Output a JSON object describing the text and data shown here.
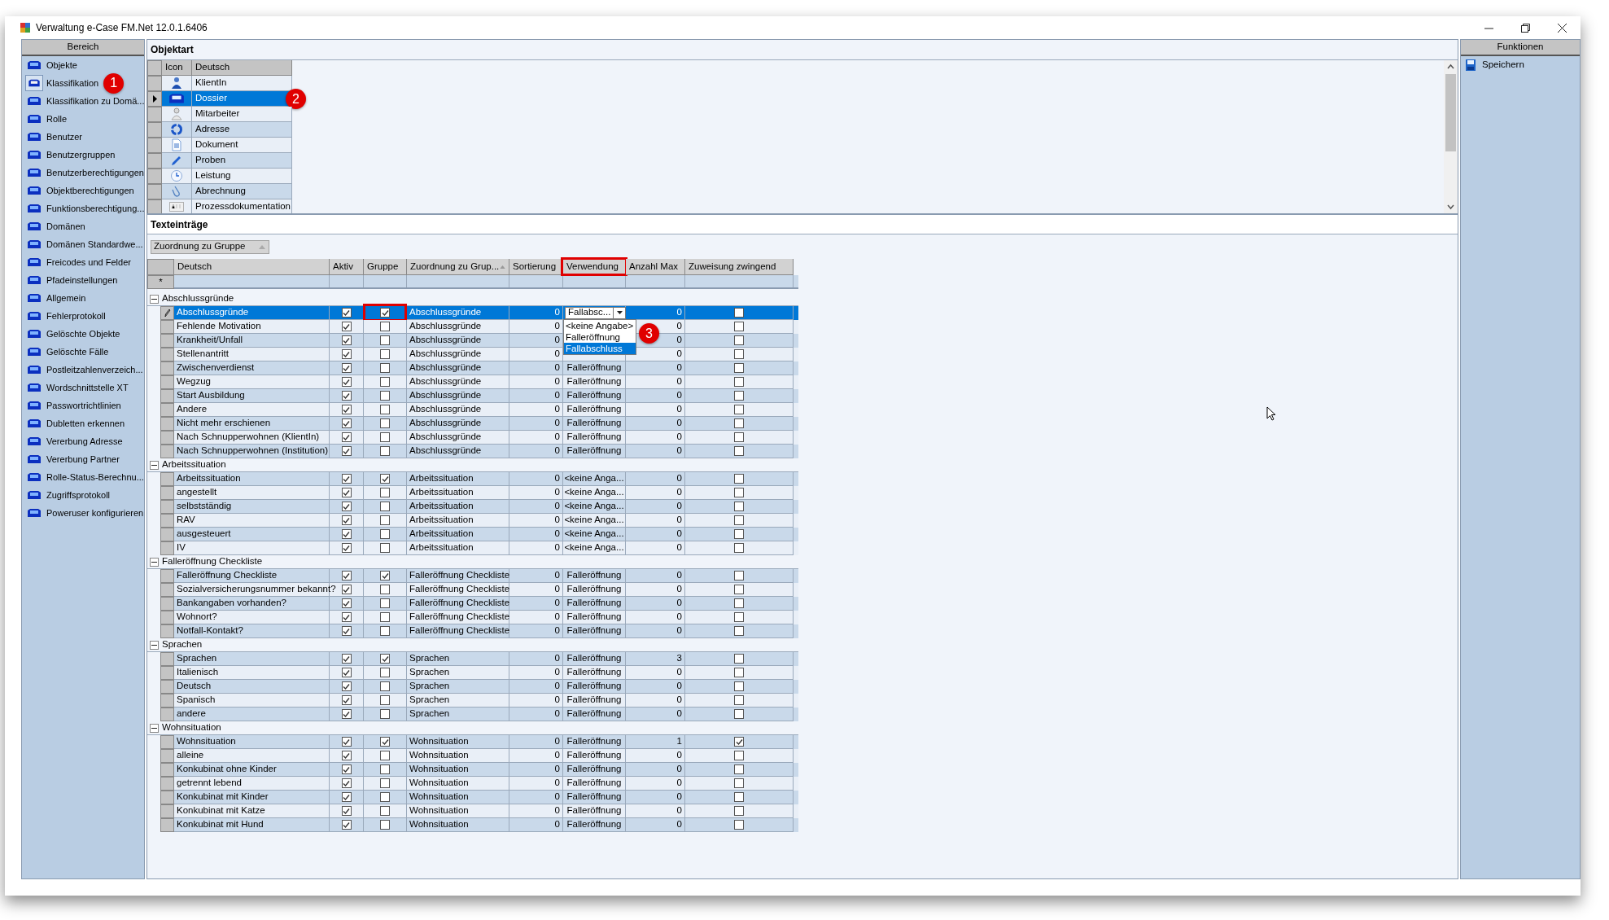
{
  "window": {
    "title": "Verwaltung e-Case FM.Net 12.0.1.6406"
  },
  "sidebar": {
    "header": "Bereich",
    "items": [
      {
        "label": "Objekte",
        "selected": false
      },
      {
        "label": "Klassifikation",
        "selected": true,
        "callout": "1"
      },
      {
        "label": "Klassifikation zu Domä...",
        "selected": false
      },
      {
        "label": "Rolle",
        "selected": false
      },
      {
        "label": "Benutzer",
        "selected": false
      },
      {
        "label": "Benutzergruppen",
        "selected": false
      },
      {
        "label": "Benutzerberechtigungen",
        "selected": false
      },
      {
        "label": "Objektberechtigungen",
        "selected": false
      },
      {
        "label": "Funktionsberechtigung...",
        "selected": false
      },
      {
        "label": "Domänen",
        "selected": false
      },
      {
        "label": "Domänen Standardwe...",
        "selected": false
      },
      {
        "label": "Freicodes und Felder",
        "selected": false
      },
      {
        "label": "Pfadeinstellungen",
        "selected": false
      },
      {
        "label": "Allgemein",
        "selected": false
      },
      {
        "label": "Fehlerprotokoll",
        "selected": false
      },
      {
        "label": "Gelöschte Objekte",
        "selected": false
      },
      {
        "label": "Gelöschte Fälle",
        "selected": false
      },
      {
        "label": "Postleitzahlenverzeich...",
        "selected": false
      },
      {
        "label": "Wordschnittstelle XT",
        "selected": false
      },
      {
        "label": "Passwortrichtlinien",
        "selected": false
      },
      {
        "label": "Dubletten erkennen",
        "selected": false
      },
      {
        "label": "Vererbung Adresse",
        "selected": false
      },
      {
        "label": "Vererbung Partner",
        "selected": false
      },
      {
        "label": "Rolle-Status-Berechnu...",
        "selected": false
      },
      {
        "label": "Zugriffsprotokoll",
        "selected": false
      },
      {
        "label": "Poweruser konfigurieren",
        "selected": false
      }
    ]
  },
  "objektart": {
    "title": "Objektart",
    "columns": [
      "Icon",
      "Deutsch"
    ],
    "rows": [
      {
        "label": "KlientIn",
        "kind": "client",
        "selected": false
      },
      {
        "label": "Dossier",
        "kind": "tray",
        "selected": true,
        "callout": "2"
      },
      {
        "label": "Mitarbeiter",
        "kind": "staff",
        "selected": false
      },
      {
        "label": "Adresse",
        "kind": "cycle",
        "selected": false
      },
      {
        "label": "Dokument",
        "kind": "document",
        "selected": false
      },
      {
        "label": "Proben",
        "kind": "pen",
        "selected": false
      },
      {
        "label": "Leistung",
        "kind": "clock",
        "selected": false
      },
      {
        "label": "Abrechnung",
        "kind": "clip",
        "selected": false
      },
      {
        "label": "Prozessdokumentation",
        "kind": "text",
        "selected": false
      }
    ]
  },
  "texteintraege": {
    "title": "Texteinträge",
    "group_by": "Zuordnung zu Gruppe",
    "new_row_marker": "*",
    "columns": [
      {
        "label": "Deutsch",
        "highlighted": false,
        "sorted": false
      },
      {
        "label": "Aktiv",
        "highlighted": false,
        "sorted": false
      },
      {
        "label": "Gruppe",
        "highlighted": false,
        "sorted": false
      },
      {
        "label": "Zuordnung zu Grup...",
        "highlighted": false,
        "sorted": true
      },
      {
        "label": "Sortierung",
        "highlighted": false,
        "sorted": false
      },
      {
        "label": "Verwendung",
        "highlighted": true,
        "sorted": false
      },
      {
        "label": "Anzahl Max",
        "highlighted": false,
        "sorted": false
      },
      {
        "label": "Zuweisung zwingend",
        "highlighted": false,
        "sorted": false
      }
    ],
    "dropdown": {
      "callout": "3",
      "options": [
        {
          "label": "<keine Angabe>",
          "selected": false
        },
        {
          "label": "Falleröffnung",
          "selected": false
        },
        {
          "label": "Fallabschluss",
          "selected": true
        }
      ]
    },
    "groups": [
      {
        "label": "Abschlussgründe",
        "expanded": true,
        "rows": [
          {
            "deutsch": "Abschlussgründe",
            "aktiv": true,
            "gruppe": true,
            "zuordnung": "Abschlussgründe",
            "sortierung": "0",
            "verwendung": "Fallabsc...",
            "editing": true,
            "anzahl_max": "0",
            "zwingend": false,
            "selected": true,
            "gruppe_highlighted": true
          },
          {
            "deutsch": "Fehlende Motivation",
            "aktiv": true,
            "gruppe": false,
            "zuordnung": "Abschlussgründe",
            "sortierung": "0",
            "anzahl_max": "0",
            "zwingend": false,
            "selected": false
          },
          {
            "deutsch": "Krankheit/Unfall",
            "aktiv": true,
            "gruppe": false,
            "zuordnung": "Abschlussgründe",
            "sortierung": "0",
            "anzahl_max": "0",
            "zwingend": false,
            "selected": false
          },
          {
            "deutsch": "Stellenantritt",
            "aktiv": true,
            "gruppe": false,
            "zuordnung": "Abschlussgründe",
            "sortierung": "0",
            "anzahl_max": "0",
            "zwingend": false,
            "selected": false
          },
          {
            "deutsch": "Zwischenverdienst",
            "aktiv": true,
            "gruppe": false,
            "zuordnung": "Abschlussgründe",
            "sortierung": "0",
            "verwendung": "Falleröffnung",
            "anzahl_max": "0",
            "zwingend": false,
            "selected": false
          },
          {
            "deutsch": "Wegzug",
            "aktiv": true,
            "gruppe": false,
            "zuordnung": "Abschlussgründe",
            "sortierung": "0",
            "verwendung": "Falleröffnung",
            "anzahl_max": "0",
            "zwingend": false,
            "selected": false
          },
          {
            "deutsch": "Start Ausbildung",
            "aktiv": true,
            "gruppe": false,
            "zuordnung": "Abschlussgründe",
            "sortierung": "0",
            "verwendung": "Falleröffnung",
            "anzahl_max": "0",
            "zwingend": false,
            "selected": false
          },
          {
            "deutsch": "Andere",
            "aktiv": true,
            "gruppe": false,
            "zuordnung": "Abschlussgründe",
            "sortierung": "0",
            "verwendung": "Falleröffnung",
            "anzahl_max": "0",
            "zwingend": false,
            "selected": false
          },
          {
            "deutsch": "Nicht mehr erschienen",
            "aktiv": true,
            "gruppe": false,
            "zuordnung": "Abschlussgründe",
            "sortierung": "0",
            "verwendung": "Falleröffnung",
            "anzahl_max": "0",
            "zwingend": false,
            "selected": false
          },
          {
            "deutsch": "Nach Schnupperwohnen (KlientIn)",
            "aktiv": true,
            "gruppe": false,
            "zuordnung": "Abschlussgründe",
            "sortierung": "0",
            "verwendung": "Falleröffnung",
            "anzahl_max": "0",
            "zwingend": false,
            "selected": false
          },
          {
            "deutsch": "Nach Schnupperwohnen (Institution)",
            "aktiv": true,
            "gruppe": false,
            "zuordnung": "Abschlussgründe",
            "sortierung": "0",
            "verwendung": "Falleröffnung",
            "anzahl_max": "0",
            "zwingend": false,
            "selected": false
          }
        ]
      },
      {
        "label": "Arbeitssituation",
        "expanded": true,
        "rows": [
          {
            "deutsch": "Arbeitssituation",
            "aktiv": true,
            "gruppe": true,
            "zuordnung": "Arbeitssituation",
            "sortierung": "0",
            "verwendung": "<keine Anga...",
            "anzahl_max": "0",
            "zwingend": false,
            "selected": false
          },
          {
            "deutsch": "angestellt",
            "aktiv": true,
            "gruppe": false,
            "zuordnung": "Arbeitssituation",
            "sortierung": "0",
            "verwendung": "<keine Anga...",
            "anzahl_max": "0",
            "zwingend": false,
            "selected": false
          },
          {
            "deutsch": "selbstständig",
            "aktiv": true,
            "gruppe": false,
            "zuordnung": "Arbeitssituation",
            "sortierung": "0",
            "verwendung": "<keine Anga...",
            "anzahl_max": "0",
            "zwingend": false,
            "selected": false
          },
          {
            "deutsch": "RAV",
            "aktiv": true,
            "gruppe": false,
            "zuordnung": "Arbeitssituation",
            "sortierung": "0",
            "verwendung": "<keine Anga...",
            "anzahl_max": "0",
            "zwingend": false,
            "selected": false
          },
          {
            "deutsch": "ausgesteuert",
            "aktiv": true,
            "gruppe": false,
            "zuordnung": "Arbeitssituation",
            "sortierung": "0",
            "verwendung": "<keine Anga...",
            "anzahl_max": "0",
            "zwingend": false,
            "selected": false
          },
          {
            "deutsch": "IV",
            "aktiv": true,
            "gruppe": false,
            "zuordnung": "Arbeitssituation",
            "sortierung": "0",
            "verwendung": "<keine Anga...",
            "anzahl_max": "0",
            "zwingend": false,
            "selected": false
          }
        ]
      },
      {
        "label": "Falleröffnung Checkliste",
        "expanded": true,
        "rows": [
          {
            "deutsch": "Falleröffnung Checkliste",
            "aktiv": true,
            "gruppe": true,
            "zuordnung": "Falleröffnung Checkliste",
            "sortierung": "0",
            "verwendung": "Falleröffnung",
            "anzahl_max": "0",
            "zwingend": false,
            "selected": false
          },
          {
            "deutsch": "Sozialversicherungsnummer bekannt?",
            "aktiv": true,
            "gruppe": false,
            "zuordnung": "Falleröffnung Checkliste",
            "sortierung": "0",
            "verwendung": "Falleröffnung",
            "anzahl_max": "0",
            "zwingend": false,
            "selected": false
          },
          {
            "deutsch": "Bankangaben vorhanden?",
            "aktiv": true,
            "gruppe": false,
            "zuordnung": "Falleröffnung Checkliste",
            "sortierung": "0",
            "verwendung": "Falleröffnung",
            "anzahl_max": "0",
            "zwingend": false,
            "selected": false
          },
          {
            "deutsch": "Wohnort?",
            "aktiv": true,
            "gruppe": false,
            "zuordnung": "Falleröffnung Checkliste",
            "sortierung": "0",
            "verwendung": "Falleröffnung",
            "anzahl_max": "0",
            "zwingend": false,
            "selected": false
          },
          {
            "deutsch": "Notfall-Kontakt?",
            "aktiv": true,
            "gruppe": false,
            "zuordnung": "Falleröffnung Checkliste",
            "sortierung": "0",
            "verwendung": "Falleröffnung",
            "anzahl_max": "0",
            "zwingend": false,
            "selected": false
          }
        ]
      },
      {
        "label": "Sprachen",
        "expanded": true,
        "rows": [
          {
            "deutsch": "Sprachen",
            "aktiv": true,
            "gruppe": true,
            "zuordnung": "Sprachen",
            "sortierung": "0",
            "verwendung": "Falleröffnung",
            "anzahl_max": "3",
            "zwingend": false,
            "selected": false
          },
          {
            "deutsch": "Italienisch",
            "aktiv": true,
            "gruppe": false,
            "zuordnung": "Sprachen",
            "sortierung": "0",
            "verwendung": "Falleröffnung",
            "anzahl_max": "0",
            "zwingend": false,
            "selected": false
          },
          {
            "deutsch": "Deutsch",
            "aktiv": true,
            "gruppe": false,
            "zuordnung": "Sprachen",
            "sortierung": "0",
            "verwendung": "Falleröffnung",
            "anzahl_max": "0",
            "zwingend": false,
            "selected": false
          },
          {
            "deutsch": "Spanisch",
            "aktiv": true,
            "gruppe": false,
            "zuordnung": "Sprachen",
            "sortierung": "0",
            "verwendung": "Falleröffnung",
            "anzahl_max": "0",
            "zwingend": false,
            "selected": false
          },
          {
            "deutsch": "andere",
            "aktiv": true,
            "gruppe": false,
            "zuordnung": "Sprachen",
            "sortierung": "0",
            "verwendung": "Falleröffnung",
            "anzahl_max": "0",
            "zwingend": false,
            "selected": false
          }
        ]
      },
      {
        "label": "Wohnsituation",
        "expanded": true,
        "rows": [
          {
            "deutsch": "Wohnsituation",
            "aktiv": true,
            "gruppe": true,
            "zuordnung": "Wohnsituation",
            "sortierung": "0",
            "verwendung": "Falleröffnung",
            "anzahl_max": "1",
            "zwingend": true,
            "selected": false
          },
          {
            "deutsch": "alleine",
            "aktiv": true,
            "gruppe": false,
            "zuordnung": "Wohnsituation",
            "sortierung": "0",
            "verwendung": "Falleröffnung",
            "anzahl_max": "0",
            "zwingend": false,
            "selected": false
          },
          {
            "deutsch": "Konkubinat ohne Kinder",
            "aktiv": true,
            "gruppe": false,
            "zuordnung": "Wohnsituation",
            "sortierung": "0",
            "verwendung": "Falleröffnung",
            "anzahl_max": "0",
            "zwingend": false,
            "selected": false
          },
          {
            "deutsch": "getrennt lebend",
            "aktiv": true,
            "gruppe": false,
            "zuordnung": "Wohnsituation",
            "sortierung": "0",
            "verwendung": "Falleröffnung",
            "anzahl_max": "0",
            "zwingend": false,
            "selected": false
          },
          {
            "deutsch": "Konkubinat mit Kinder",
            "aktiv": true,
            "gruppe": false,
            "zuordnung": "Wohnsituation",
            "sortierung": "0",
            "verwendung": "Falleröffnung",
            "anzahl_max": "0",
            "zwingend": false,
            "selected": false
          },
          {
            "deutsch": "Konkubinat mit Katze",
            "aktiv": true,
            "gruppe": false,
            "zuordnung": "Wohnsituation",
            "sortierung": "0",
            "verwendung": "Falleröffnung",
            "anzahl_max": "0",
            "zwingend": false,
            "selected": false
          },
          {
            "deutsch": "Konkubinat mit Hund",
            "aktiv": true,
            "gruppe": false,
            "zuordnung": "Wohnsituation",
            "sortierung": "0",
            "verwendung": "Falleröffnung",
            "anzahl_max": "0",
            "zwingend": false,
            "selected": false
          }
        ]
      }
    ]
  },
  "functions": {
    "header": "Funktionen",
    "items": [
      "Speichern"
    ]
  }
}
